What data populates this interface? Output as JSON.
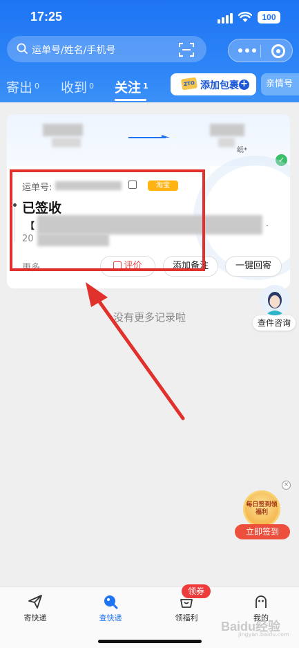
{
  "status_bar": {
    "time": "17:25",
    "battery": "100"
  },
  "search": {
    "placeholder": "运单号/姓名/手机号"
  },
  "tabs": [
    {
      "label": "寄出",
      "count": "0"
    },
    {
      "label": "收到",
      "count": "0"
    },
    {
      "label": "关注",
      "count": "1",
      "active": true
    }
  ],
  "add_package": {
    "logo": "ZTO",
    "label": "添加包裹",
    "plus": "+"
  },
  "family_label": "亲情号",
  "card": {
    "route_tail": "纸*",
    "waybill_label": "运单号:",
    "source_tag": "淘宝",
    "status": "已签收",
    "detail_prefix": "【",
    "detail_suffix": ".",
    "date_prefix": "20",
    "more_label": "更多",
    "actions": [
      "评价",
      "添加备注",
      "一键回寄"
    ]
  },
  "no_more_text": "没有更多记录啦",
  "assistant_label": "查件咨询",
  "daily_sign": {
    "badge_text": "每日签到领福利",
    "button_label": "立即签到",
    "close": "×"
  },
  "bottom_nav": [
    {
      "label": "寄快递",
      "icon": "send-icon"
    },
    {
      "label": "查快递",
      "icon": "search-express-icon",
      "active": true
    },
    {
      "label": "领福利",
      "icon": "gift-icon"
    },
    {
      "label": "我的",
      "icon": "profile-icon"
    }
  ],
  "coupon_badge": "领券",
  "watermark": {
    "main": "Baidu经验",
    "sub": "jingyan.baidu.com"
  },
  "colors": {
    "brand_blue": "#1e74f3",
    "highlight_red": "#e0312c",
    "taobao_orange": "#ffb413"
  }
}
